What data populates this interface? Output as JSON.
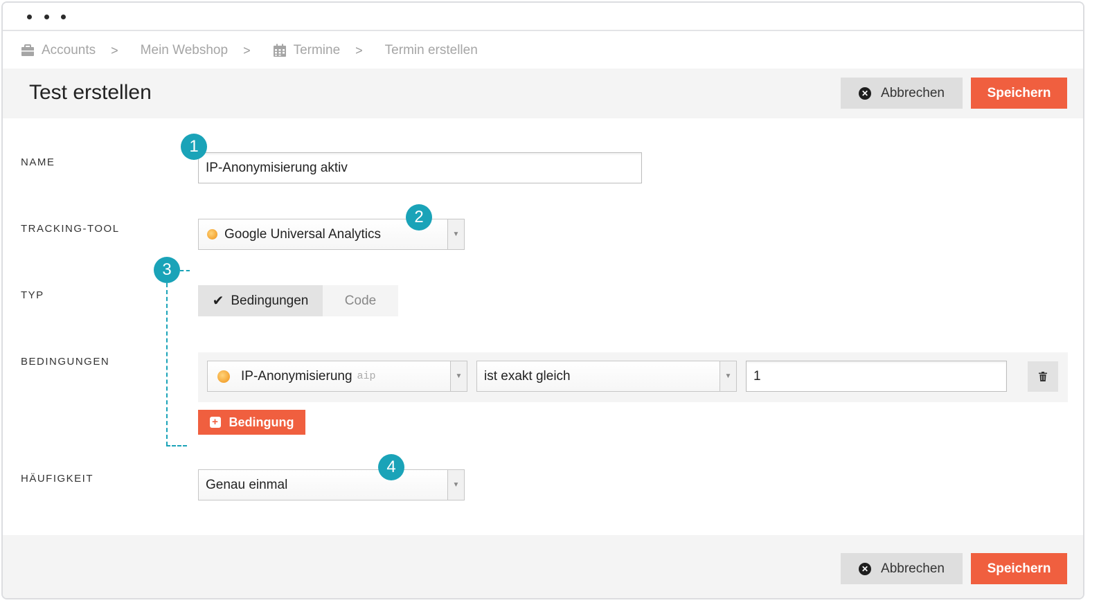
{
  "breadcrumb": {
    "items": [
      {
        "label": "Accounts",
        "icon": "briefcase-icon"
      },
      {
        "label": "Mein Webshop"
      },
      {
        "label": "Termine",
        "icon": "calendar-icon"
      },
      {
        "label": "Termin erstellen"
      }
    ]
  },
  "header": {
    "title": "Test erstellen",
    "cancel_label": "Abbrechen",
    "save_label": "Speichern"
  },
  "form": {
    "name": {
      "label": "NAME",
      "value": "IP-Anonymisierung aktiv"
    },
    "tracking_tool": {
      "label": "TRACKING-TOOL",
      "value": "Google Universal Analytics"
    },
    "typ": {
      "label": "TYP",
      "options": [
        "Bedingungen",
        "Code"
      ],
      "selected": "Bedingungen"
    },
    "bedingungen": {
      "label": "BEDINGUNGEN",
      "rows": [
        {
          "parameter": "IP-Anonymisierung",
          "code": "aip",
          "operator": "ist exakt gleich",
          "value": "1"
        }
      ],
      "add_label": "Bedingung"
    },
    "haeufigkeit": {
      "label": "HÄUFIGKEIT",
      "value": "Genau einmal"
    }
  },
  "footer": {
    "cancel_label": "Abbrechen",
    "save_label": "Speichern"
  },
  "callouts": [
    "1",
    "2",
    "3",
    "4"
  ],
  "colors": {
    "accent": "#f05f3f",
    "callout": "#1aa3b8"
  }
}
